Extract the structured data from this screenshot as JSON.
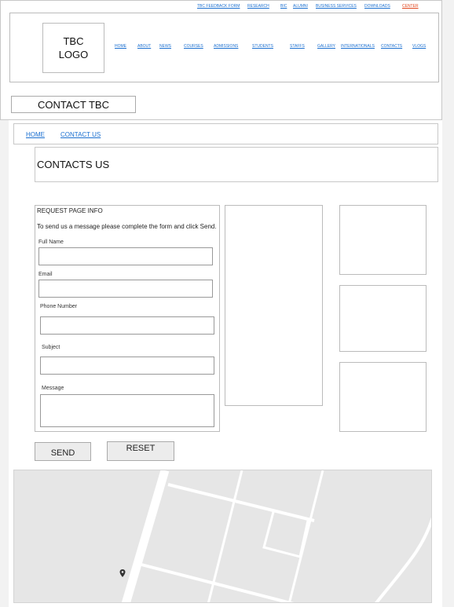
{
  "topbar": {
    "links": [
      "TBC FEEDBACK FORM",
      "RESEARCH",
      "BIC",
      "ALUMNI",
      "BUSINESS SERVICES",
      "DOWNLOADS",
      "CENTER"
    ],
    "highlight_color": "#e0441b"
  },
  "header": {
    "logo_text": "TBC\nLOGO",
    "nav": [
      "HOME",
      "ABOUT",
      "NEWS",
      "COURSES",
      "ADMISSIONS",
      "STUDENTS",
      "STAFFS",
      "GALLERY",
      "INTERNATIONALS",
      "CONTACTS",
      "VLOGS"
    ]
  },
  "page_title_box": "CONTACT TBC",
  "breadcrumb": {
    "home": "HOME",
    "current": "CONTACT US"
  },
  "heading": "CONTACTS US",
  "form": {
    "title": "REQUEST PAGE INFO",
    "intro": "To send us a message please complete the form and click Send.",
    "fields": {
      "full_name": {
        "label": "Full Name",
        "value": ""
      },
      "email": {
        "label": "Email",
        "value": ""
      },
      "phone": {
        "label": "Phone Number",
        "value": ""
      },
      "subject": {
        "label": "Subject",
        "value": ""
      },
      "message": {
        "label": "Message",
        "value": ""
      }
    },
    "send_label": "SEND",
    "reset_label": "RESET"
  },
  "colors": {
    "link": "#1a6fd0",
    "map_bg": "#e6e6e6",
    "map_road": "#ffffff"
  },
  "map": {
    "marker_icon": "map-pin-icon"
  }
}
